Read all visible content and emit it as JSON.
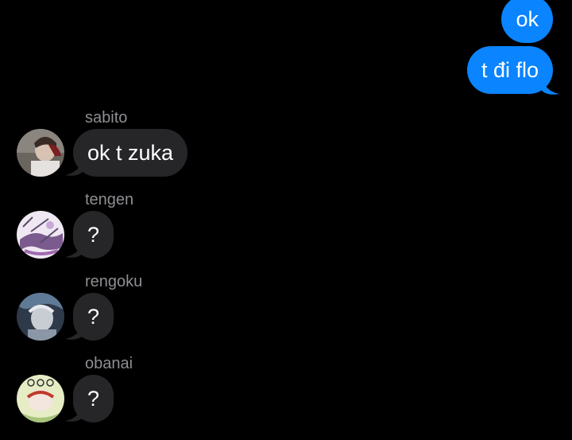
{
  "outgoing": [
    {
      "text": "ok"
    },
    {
      "text": "t đi flo"
    }
  ],
  "incoming": [
    {
      "sender": "sabito",
      "text": "ok t zuka",
      "avatar_icon": "sabito-avatar"
    },
    {
      "sender": "tengen",
      "text": "?",
      "avatar_icon": "tengen-avatar"
    },
    {
      "sender": "rengoku",
      "text": "?",
      "avatar_icon": "rengoku-avatar"
    },
    {
      "sender": "obanai",
      "text": "?",
      "avatar_icon": "obanai-avatar"
    }
  ],
  "colors": {
    "background": "#000000",
    "outgoing_bubble": "#0a84ff",
    "incoming_bubble": "#262629",
    "sender_name": "#8e8e93"
  }
}
